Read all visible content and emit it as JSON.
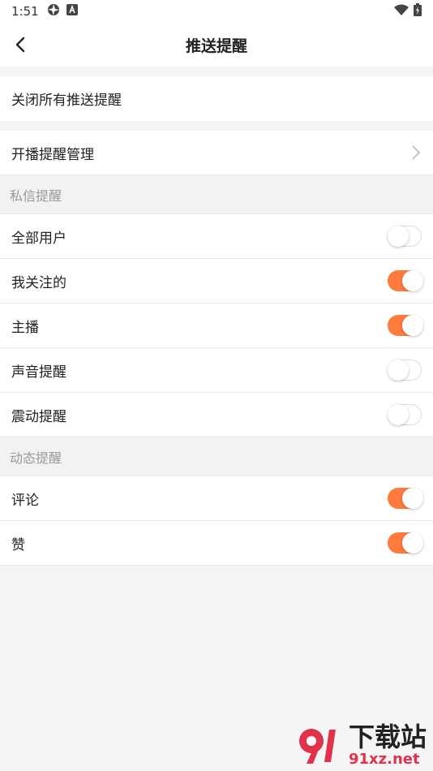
{
  "status": {
    "time": "1:51"
  },
  "header": {
    "title": "推送提醒"
  },
  "close_all": {
    "label": "关闭所有推送提醒"
  },
  "live_manage": {
    "label": "开播提醒管理"
  },
  "private_section": {
    "title": "私信提醒",
    "items": [
      {
        "label": "全部用户",
        "on": false
      },
      {
        "label": "我关注的",
        "on": true
      },
      {
        "label": "主播",
        "on": true
      },
      {
        "label": "声音提醒",
        "on": false
      },
      {
        "label": "震动提醒",
        "on": false
      }
    ]
  },
  "dynamic_section": {
    "title": "动态提醒",
    "items": [
      {
        "label": "评论",
        "on": true
      },
      {
        "label": "赞",
        "on": true
      }
    ]
  },
  "watermark": {
    "text_cn": "下载站",
    "text_en": "91xz.net"
  },
  "colors": {
    "accent": "#ff7a3d",
    "watermark_red": "#e0324d"
  }
}
